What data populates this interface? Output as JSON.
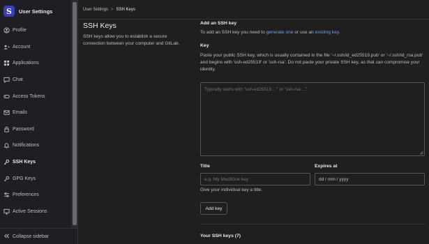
{
  "sidebar": {
    "title": "User Settings",
    "avatar_letter": "S",
    "items": [
      {
        "label": "Profile",
        "icon": "profile-icon"
      },
      {
        "label": "Account",
        "icon": "account-icon"
      },
      {
        "label": "Applications",
        "icon": "applications-icon"
      },
      {
        "label": "Chat",
        "icon": "chat-icon"
      },
      {
        "label": "Access Tokens",
        "icon": "token-icon"
      },
      {
        "label": "Emails",
        "icon": "mail-icon"
      },
      {
        "label": "Password",
        "icon": "lock-icon"
      },
      {
        "label": "Notifications",
        "icon": "bell-icon"
      },
      {
        "label": "SSH Keys",
        "icon": "key-icon"
      },
      {
        "label": "GPG Keys",
        "icon": "key-icon"
      },
      {
        "label": "Preferences",
        "icon": "preferences-icon"
      },
      {
        "label": "Active Sessions",
        "icon": "monitor-icon"
      }
    ],
    "collapse_label": "Collapse sidebar"
  },
  "breadcrumb": {
    "parent": "User Settings",
    "separator": ">",
    "current": "SSH Keys"
  },
  "description": {
    "title": "SSH Keys",
    "text": "SSH keys allow you to establish a secure connection between your computer and GitLab."
  },
  "form": {
    "heading": "Add an SSH key",
    "intro_prefix": "To add an SSH key you need to ",
    "intro_link1": "generate one",
    "intro_middle": " or use an ",
    "intro_link2": "existing key",
    "intro_suffix": ".",
    "key_label": "Key",
    "key_help": "Paste your public SSH key, which is usually contained in the file '~/.ssh/id_ed25519.pub' or '~/.ssh/id_rsa.pub' and begins with 'ssh-ed25519' or 'ssh-rsa'. Do not paste your private SSH key, as that can compromise your identity.",
    "key_placeholder": "Typically starts with \"ssh-ed25519 ...\" or \"ssh-rsa ...\"",
    "title_label": "Title",
    "title_placeholder": "e.g. My MacBook key",
    "title_help": "Give your individual key a title.",
    "expires_label": "Expires at",
    "expires_placeholder": "dd / mm / yyyy",
    "add_button": "Add key",
    "your_keys": "Your SSH keys (7)"
  },
  "colors": {
    "link": "#6ea2f5",
    "avatar": "#3e3db3",
    "background": "#1f1f1f"
  }
}
